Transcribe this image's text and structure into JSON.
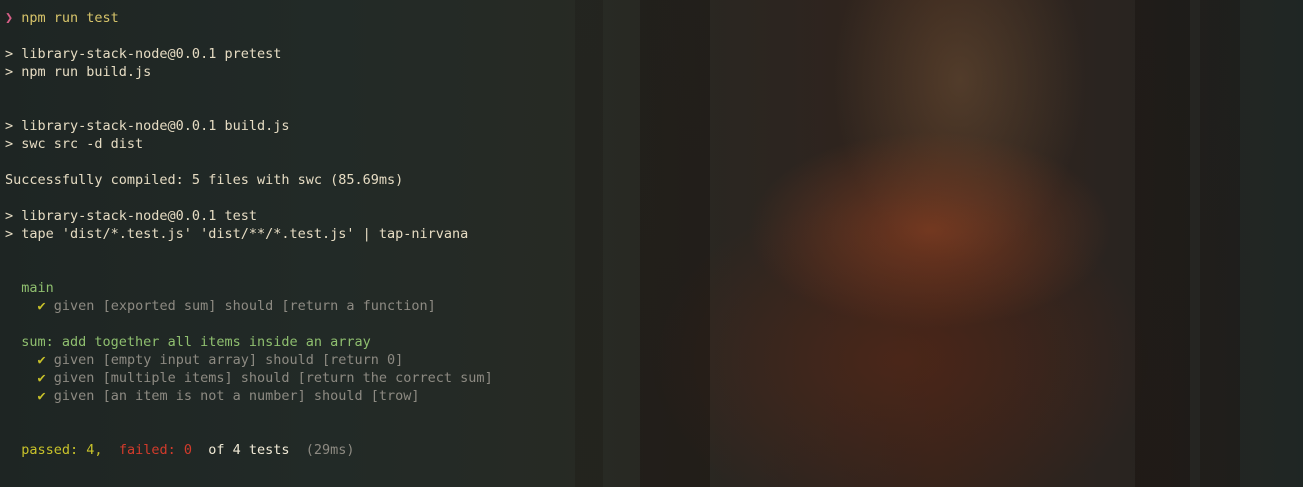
{
  "terminal": {
    "prompt_symbol": "❯",
    "command": "npm run test",
    "pretest_script": "> library-stack-node@0.0.1 pretest",
    "pretest_cmd": "> npm run build.js",
    "build_script": "> library-stack-node@0.0.1 build.js",
    "build_cmd": "> swc src -d dist",
    "compile_result": "Successfully compiled: 5 files with swc (85.69ms)",
    "test_script": "> library-stack-node@0.0.1 test",
    "test_cmd": "> tape 'dist/*.test.js' 'dist/**/*.test.js' | tap-nirvana",
    "check_mark": "✔",
    "suites": [
      {
        "name": "main",
        "tests": [
          "given [exported sum] should [return a function]"
        ]
      },
      {
        "name": "sum: add together all items inside an array",
        "tests": [
          "given [empty input array] should [return 0]",
          "given [multiple items] should [return the correct sum]",
          "given [an item is not a number] should [trow]"
        ]
      }
    ],
    "summary": {
      "passed": "passed: 4,",
      "failed": "failed: 0",
      "total": "of 4 tests",
      "duration": "(29ms)"
    }
  },
  "colors": {
    "prompt": "#d75f87",
    "command": "#d7c46a",
    "suite_title": "#8fbf6f",
    "check": "#c8c22a",
    "passed": "#c8c22a",
    "failed": "#d23b2b",
    "dim_text": "#8d8a82"
  }
}
